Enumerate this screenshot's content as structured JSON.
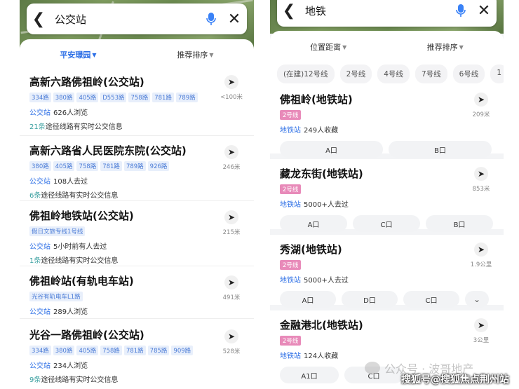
{
  "left": {
    "search": {
      "query": "公交站"
    },
    "filters": {
      "area": "平安璟园",
      "sort": "推荐排序"
    },
    "results": [
      {
        "title": "高新六路佛祖岭(公交站)",
        "tags": [
          "334路",
          "380路",
          "405路",
          "D553路",
          "758路",
          "781路",
          "789路"
        ],
        "kind": "公交站",
        "stat": "626人浏览",
        "sub_num": "21条",
        "sub_text": "途径线路有实时公交信息",
        "distance": "<100米"
      },
      {
        "title": "高新六路省人民医院东院(公交站)",
        "tags": [
          "380路",
          "405路",
          "758路",
          "781路",
          "789路",
          "926路"
        ],
        "kind": "公交站",
        "stat": "108人去过",
        "sub_num": "6条",
        "sub_text": "途径线路有实时公交信息",
        "distance": "246米"
      },
      {
        "title": "佛祖岭地铁站(公交站)",
        "tags": [
          "假日文旅专线1号线"
        ],
        "kind": "公交站",
        "stat": "5小时前有人去过",
        "sub_num": "1条",
        "sub_text": "途径线路有实时公交信息",
        "distance": "215米"
      },
      {
        "title": "佛祖岭站(有轨电车站)",
        "tags": [
          "光谷有轨电车L1路"
        ],
        "kind": "公交站",
        "stat": "289人浏览",
        "sub_num": "",
        "sub_text": "",
        "distance": "491米"
      },
      {
        "title": "光谷一路佛祖岭(公交站)",
        "tags": [
          "334路",
          "380路",
          "405路",
          "758路",
          "781路",
          "785路",
          "909路"
        ],
        "kind": "公交站",
        "stat": "234人浏览",
        "sub_num": "9条",
        "sub_text": "途径线路有实时公交信息",
        "distance": "528米"
      }
    ]
  },
  "right": {
    "search": {
      "query": "地铁"
    },
    "filters": {
      "distance": "位置距离",
      "sort": "推荐排序"
    },
    "chips": [
      "(在建)12号线",
      "2号线",
      "4号线",
      "7号线",
      "6号线",
      "1"
    ],
    "results": [
      {
        "title": "佛祖岭(地铁站)",
        "line": "2号线",
        "kind": "地铁站",
        "stat": "249人收藏",
        "distance": "209米",
        "exits": [
          "A口",
          "B口"
        ]
      },
      {
        "title": "藏龙东街(地铁站)",
        "line": "2号线",
        "kind": "地铁站",
        "stat": "5000+人去过",
        "distance": "853米",
        "exits": [
          "A口",
          "C口",
          "B口"
        ]
      },
      {
        "title": "秀湖(地铁站)",
        "line": "2号线",
        "kind": "地铁站",
        "stat": "5000+人去过",
        "distance": "1.9公里",
        "exits": [
          "A口",
          "D口",
          "C口"
        ]
      },
      {
        "title": "金融港北(地铁站)",
        "line": "2号线",
        "kind": "地铁站",
        "stat": "124人收藏",
        "distance": "3公里",
        "exits": [
          "A1口",
          "C口"
        ]
      }
    ]
  },
  "watermark": "公众号 · 波哥地产",
  "source": "搜狐号@搜狐焦点荆州站"
}
